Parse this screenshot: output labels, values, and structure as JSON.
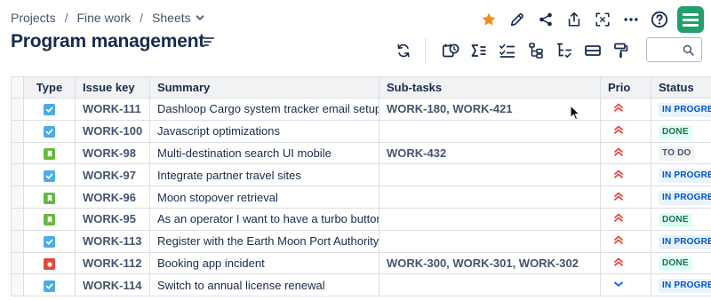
{
  "breadcrumb": {
    "items": [
      "Projects",
      "Fine work",
      "Sheets"
    ],
    "separator": "/"
  },
  "page": {
    "title": "Program management"
  },
  "top_actions": [
    "star-icon",
    "edit-icon",
    "share-icon",
    "export-icon",
    "fullscreen-icon",
    "more-icon",
    "help-icon",
    "app-logo"
  ],
  "toolbar": [
    "refresh-icon",
    "time-tracking-icon",
    "sum-icon",
    "checklist-icon",
    "hierarchy-icon",
    "tree-icon",
    "row-height-icon",
    "format-painter-icon"
  ],
  "search": {
    "placeholder": "",
    "value": ""
  },
  "colors": {
    "star": "#f18d13",
    "task": "#4bade8",
    "story": "#63ba3c",
    "bug": "#e5493a",
    "prio_high": "#e5493a",
    "prio_low": "#0065ff"
  },
  "table": {
    "headers": [
      "Type",
      "Issue key",
      "Summary",
      "Sub-tasks",
      "Prio",
      "Status"
    ],
    "rows": [
      {
        "type": "task",
        "key": "WORK-111",
        "summary": "Dashloop Cargo system tracker email setup",
        "subtasks": "WORK-180, WORK-421",
        "prio": "high",
        "status": "IN PROGRESS",
        "status_kind": "inprog"
      },
      {
        "type": "task",
        "key": "WORK-100",
        "summary": "Javascript optimizations",
        "subtasks": "",
        "prio": "high",
        "status": "DONE",
        "status_kind": "done"
      },
      {
        "type": "story",
        "key": "WORK-98",
        "summary": "Multi-destination search UI mobile",
        "subtasks": "WORK-432",
        "prio": "high",
        "status": "TO DO",
        "status_kind": "todo"
      },
      {
        "type": "task",
        "key": "WORK-97",
        "summary": "Integrate partner travel sites",
        "subtasks": "",
        "prio": "high",
        "status": "IN PROGRESS",
        "status_kind": "inprog"
      },
      {
        "type": "story",
        "key": "WORK-96",
        "summary": "Moon stopover retrieval",
        "subtasks": "",
        "prio": "high",
        "status": "IN PROGRESS",
        "status_kind": "inprog"
      },
      {
        "type": "story",
        "key": "WORK-95",
        "summary": "As an operator I want to have a turbo button",
        "subtasks": "",
        "prio": "high",
        "status": "DONE",
        "status_kind": "done"
      },
      {
        "type": "task",
        "key": "WORK-113",
        "summary": "Register with the Earth Moon Port Authority",
        "subtasks": "",
        "prio": "high",
        "status": "IN PROGRESS",
        "status_kind": "inprog"
      },
      {
        "type": "bug",
        "key": "WORK-112",
        "summary": "Booking app incident",
        "subtasks": "WORK-300, WORK-301, WORK-302",
        "prio": "high",
        "status": "DONE",
        "status_kind": "done"
      },
      {
        "type": "task",
        "key": "WORK-114",
        "summary": "Switch to annual license renewal",
        "subtasks": "",
        "prio": "low",
        "status": "IN PROGRESS",
        "status_kind": "inprog"
      }
    ]
  }
}
